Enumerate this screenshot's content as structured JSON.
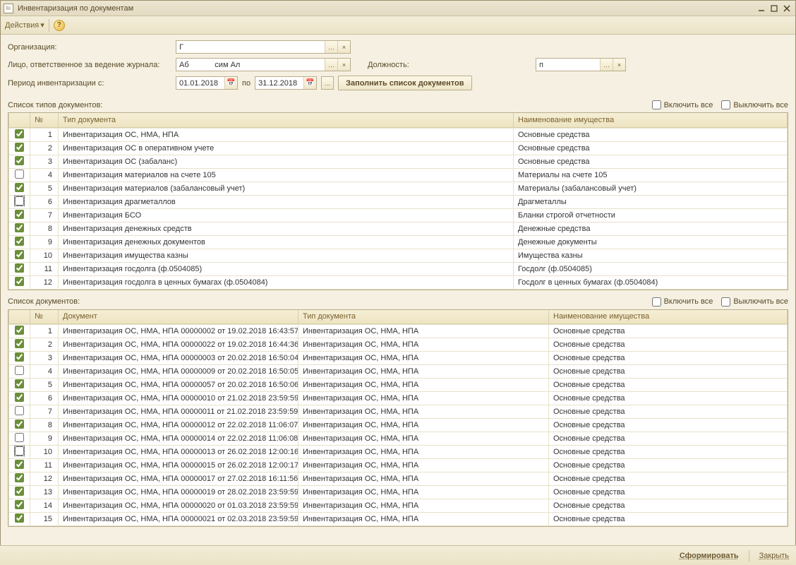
{
  "window": {
    "title": "Инвентаризация по документам"
  },
  "toolbar": {
    "actions_label": "Действия"
  },
  "form": {
    "org_label": "Организация:",
    "org_value": "Г",
    "person_label": "Лицо, ответственное за ведение журнала:",
    "person_value": "Аб            сим Ал",
    "position_label": "Должность:",
    "position_value": "п",
    "period_label": "Период инвентаризации с:",
    "date_from": "01.01.2018",
    "date_sep": "по",
    "date_to": "31.12.2018",
    "fill_btn": "Заполнить список документов"
  },
  "types_section": {
    "label": "Список типов документов:",
    "enable_all": "Включить все",
    "disable_all": "Выключить все",
    "headers": {
      "num": "№",
      "type": "Тип документа",
      "name": "Наименование имущества"
    },
    "rows": [
      {
        "chk": true,
        "num": 1,
        "type": "Инвентаризация ОС, НМА, НПА",
        "name": "Основные средства"
      },
      {
        "chk": true,
        "num": 2,
        "type": "Инвентаризация ОС в оперативном учете",
        "name": "Основные средства"
      },
      {
        "chk": true,
        "num": 3,
        "type": "Инвентаризация ОС (забаланс)",
        "name": "Основные средства"
      },
      {
        "chk": false,
        "num": 4,
        "type": "Инвентаризация материалов на счете 105",
        "name": "Материалы на счете 105"
      },
      {
        "chk": true,
        "num": 5,
        "type": "Инвентаризация материалов (забалансовый учет)",
        "name": "Материалы (забалансовый учет)"
      },
      {
        "chk": false,
        "num": 6,
        "type": "Инвентаризация драгметаллов",
        "name": "Драгметаллы",
        "focus": true
      },
      {
        "chk": true,
        "num": 7,
        "type": "Инвентаризация БСО",
        "name": "Бланки строгой отчетности"
      },
      {
        "chk": true,
        "num": 8,
        "type": "Инвентаризация денежных средств",
        "name": "Денежные средства"
      },
      {
        "chk": true,
        "num": 9,
        "type": "Инвентаризация денежных документов",
        "name": "Денежные документы"
      },
      {
        "chk": true,
        "num": 10,
        "type": "Инвентаризация имущества казны",
        "name": "Имущества казны"
      },
      {
        "chk": true,
        "num": 11,
        "type": "Инвентаризация госдолга (ф.0504085)",
        "name": "Госдолг (ф.0504085)"
      },
      {
        "chk": true,
        "num": 12,
        "type": "Инвентаризация госдолга в ценных бумагах (ф.0504084)",
        "name": "Госдолг в ценных бумагах (ф.0504084)"
      }
    ]
  },
  "docs_section": {
    "label": "Список документов:",
    "enable_all": "Включить все",
    "disable_all": "Выключить все",
    "headers": {
      "num": "№",
      "doc": "Документ",
      "type": "Тип документа",
      "name": "Наименование имущества"
    },
    "rows": [
      {
        "chk": true,
        "num": 1,
        "doc": "Инвентаризация ОС, НМА, НПА 00000002 от 19.02.2018 16:43:57",
        "type": "Инвентаризация ОС, НМА, НПА",
        "name": "Основные средства"
      },
      {
        "chk": true,
        "num": 2,
        "doc": "Инвентаризация ОС, НМА, НПА 00000022 от 19.02.2018 16:44:36",
        "type": "Инвентаризация ОС, НМА, НПА",
        "name": "Основные средства"
      },
      {
        "chk": true,
        "num": 3,
        "doc": "Инвентаризация ОС, НМА, НПА 00000003 от 20.02.2018 16:50:04",
        "type": "Инвентаризация ОС, НМА, НПА",
        "name": "Основные средства"
      },
      {
        "chk": false,
        "num": 4,
        "doc": "Инвентаризация ОС, НМА, НПА 00000009 от 20.02.2018 16:50:05",
        "type": "Инвентаризация ОС, НМА, НПА",
        "name": "Основные средства"
      },
      {
        "chk": true,
        "num": 5,
        "doc": "Инвентаризация ОС, НМА, НПА 00000057 от 20.02.2018 16:50:06",
        "type": "Инвентаризация ОС, НМА, НПА",
        "name": "Основные средства"
      },
      {
        "chk": true,
        "num": 6,
        "doc": "Инвентаризация ОС, НМА, НПА 00000010 от 21.02.2018 23:59:59",
        "type": "Инвентаризация ОС, НМА, НПА",
        "name": "Основные средства"
      },
      {
        "chk": false,
        "num": 7,
        "doc": "Инвентаризация ОС, НМА, НПА 00000011 от 21.02.2018 23:59:59",
        "type": "Инвентаризация ОС, НМА, НПА",
        "name": "Основные средства"
      },
      {
        "chk": true,
        "num": 8,
        "doc": "Инвентаризация ОС, НМА, НПА 00000012 от 22.02.2018 11:06:07",
        "type": "Инвентаризация ОС, НМА, НПА",
        "name": "Основные средства"
      },
      {
        "chk": false,
        "num": 9,
        "doc": "Инвентаризация ОС, НМА, НПА 00000014 от 22.02.2018 11:06:08",
        "type": "Инвентаризация ОС, НМА, НПА",
        "name": "Основные средства"
      },
      {
        "chk": false,
        "num": 10,
        "doc": "Инвентаризация ОС, НМА, НПА 00000013 от 26.02.2018 12:00:16",
        "type": "Инвентаризация ОС, НМА, НПА",
        "name": "Основные средства",
        "focus": true
      },
      {
        "chk": true,
        "num": 11,
        "doc": "Инвентаризация ОС, НМА, НПА 00000015 от 26.02.2018 12:00:17",
        "type": "Инвентаризация ОС, НМА, НПА",
        "name": "Основные средства"
      },
      {
        "chk": true,
        "num": 12,
        "doc": "Инвентаризация ОС, НМА, НПА 00000017 от 27.02.2018 16:11:56",
        "type": "Инвентаризация ОС, НМА, НПА",
        "name": "Основные средства"
      },
      {
        "chk": true,
        "num": 13,
        "doc": "Инвентаризация ОС, НМА, НПА 00000019 от 28.02.2018 23:59:59",
        "type": "Инвентаризация ОС, НМА, НПА",
        "name": "Основные средства"
      },
      {
        "chk": true,
        "num": 14,
        "doc": "Инвентаризация ОС, НМА, НПА 00000020 от 01.03.2018 23:59:59",
        "type": "Инвентаризация ОС, НМА, НПА",
        "name": "Основные средства"
      },
      {
        "chk": true,
        "num": 15,
        "doc": "Инвентаризация ОС, НМА, НПА 00000021 от 02.03.2018 23:59:59",
        "type": "Инвентаризация ОС, НМА, НПА",
        "name": "Основные средства"
      }
    ]
  },
  "footer": {
    "generate": "Сформировать",
    "close": "Закрыть"
  }
}
